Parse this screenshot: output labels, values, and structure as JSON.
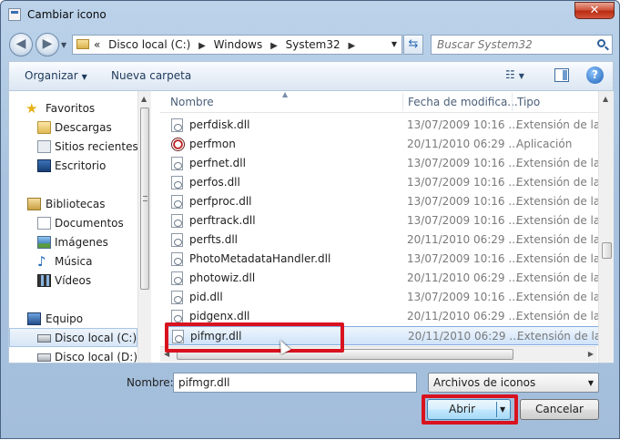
{
  "window": {
    "title": "Cambiar icono",
    "close_label": "✕"
  },
  "address": {
    "history_glyph": "«",
    "crumbs": [
      "Disco local (C:)",
      "Windows",
      "System32"
    ],
    "search_placeholder": "Buscar System32"
  },
  "toolbar": {
    "organize": "Organizar",
    "new_folder": "Nueva carpeta"
  },
  "nav": {
    "favorites": "Favoritos",
    "downloads": "Descargas",
    "recent": "Sitios recientes",
    "desktop": "Escritorio",
    "libraries": "Bibliotecas",
    "documents": "Documentos",
    "images": "Imágenes",
    "music": "Música",
    "videos": "Vídeos",
    "computer": "Equipo",
    "drive_c": "Disco local (C:)",
    "drive_d": "Disco local (D:)"
  },
  "columns": {
    "name": "Nombre",
    "date": "Fecha de modifica...",
    "type": "Tipo"
  },
  "files": [
    {
      "name": "perfdisk.dll",
      "date": "13/07/2009 10:16 ...",
      "type": "Extensión de la ap",
      "icon": "dll-icon"
    },
    {
      "name": "perfmon",
      "date": "20/11/2010 06:29 ...",
      "type": "Aplicación",
      "icon": "app-icon"
    },
    {
      "name": "perfnet.dll",
      "date": "13/07/2009 10:16 ...",
      "type": "Extensión de la ap",
      "icon": "dll-icon"
    },
    {
      "name": "perfos.dll",
      "date": "13/07/2009 10:16 ...",
      "type": "Extensión de la ap",
      "icon": "dll-icon"
    },
    {
      "name": "perfproc.dll",
      "date": "13/07/2009 10:16 ...",
      "type": "Extensión de la ap",
      "icon": "dll-icon"
    },
    {
      "name": "perftrack.dll",
      "date": "13/07/2009 10:16 ...",
      "type": "Extensión de la ap",
      "icon": "dll-icon"
    },
    {
      "name": "perfts.dll",
      "date": "20/11/2010 06:29 ...",
      "type": "Extensión de la ap",
      "icon": "dll-icon"
    },
    {
      "name": "PhotoMetadataHandler.dll",
      "date": "13/07/2009 10:16 ...",
      "type": "Extensión de la ap",
      "icon": "dll-icon"
    },
    {
      "name": "photowiz.dll",
      "date": "20/11/2010 06:29 ...",
      "type": "Extensión de la ap",
      "icon": "dll-icon"
    },
    {
      "name": "pid.dll",
      "date": "13/07/2009 10:16 ...",
      "type": "Extensión de la ap",
      "icon": "dll-icon"
    },
    {
      "name": "pidgenx.dll",
      "date": "20/11/2010 06:29 ...",
      "type": "Extensión de la ap",
      "icon": "dll-icon"
    },
    {
      "name": "pifmgr.dll",
      "date": "20/11/2010 06:29 ...",
      "type": "Extensión de la ap",
      "icon": "dll-icon",
      "selected": true
    }
  ],
  "bottom": {
    "name_label": "Nombre:",
    "filename": "pifmgr.dll",
    "filter": "Archivos de iconos",
    "open": "Abrir",
    "cancel": "Cancelar"
  }
}
